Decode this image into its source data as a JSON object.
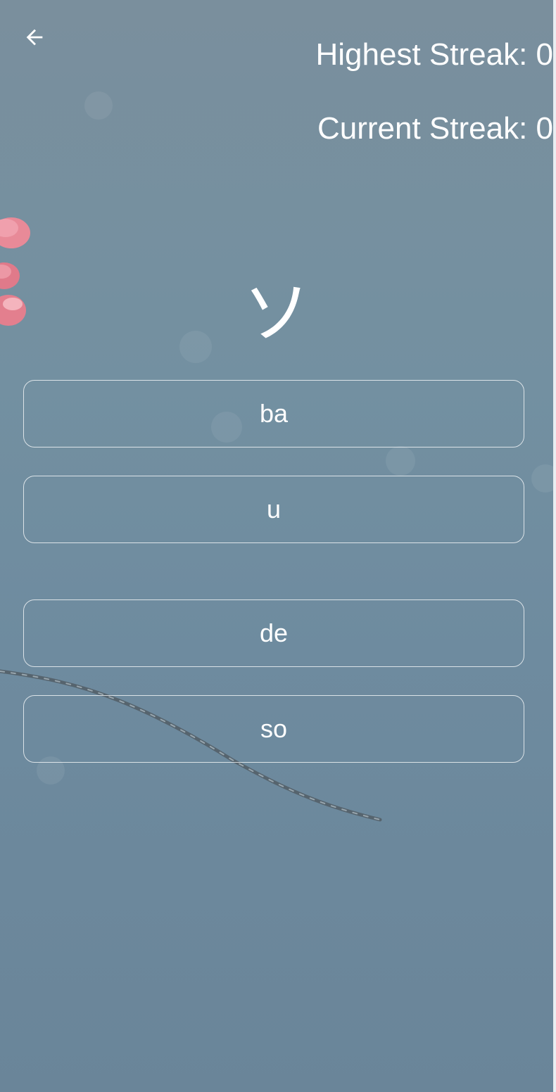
{
  "header": {
    "back_icon": "arrow-left-icon",
    "highest_streak": "Highest Streak: 0",
    "current_streak": "Current Streak: 0"
  },
  "quiz": {
    "character": "ソ",
    "options": [
      {
        "label": "ba"
      },
      {
        "label": "u"
      },
      {
        "label": "de"
      },
      {
        "label": "so"
      }
    ]
  },
  "colors": {
    "background": "#7390a1",
    "text": "#ffffff",
    "blossom": "#e07a8a",
    "branch": "#4f5d68"
  }
}
